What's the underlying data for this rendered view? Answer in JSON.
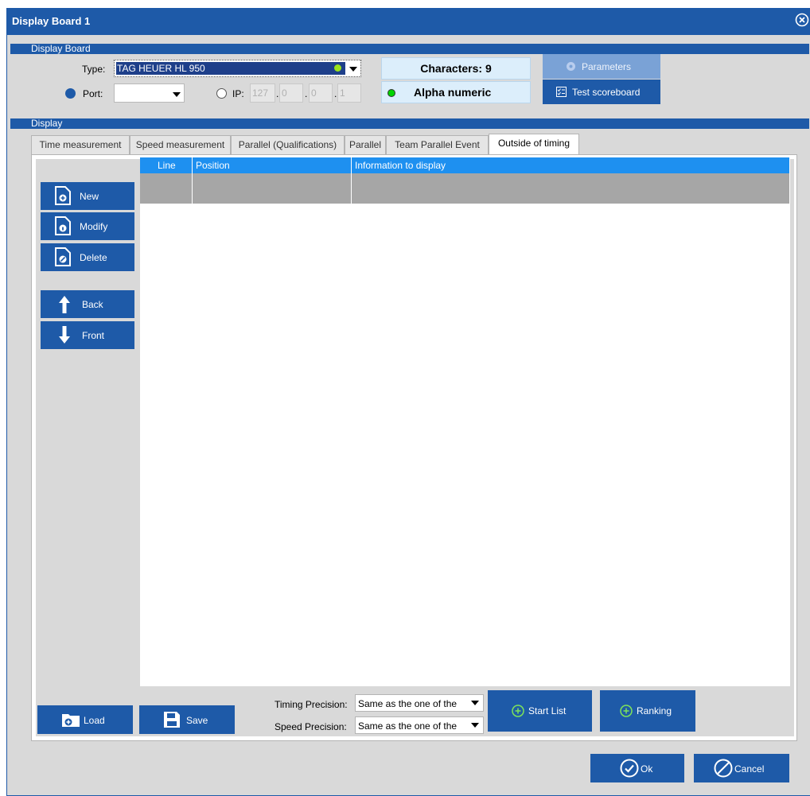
{
  "window": {
    "title": "Display Board 1"
  },
  "display_board": {
    "section_label": "Display Board",
    "type_label": "Type:",
    "type_value": "TAG HEUER HL 950",
    "port_label": "Port:",
    "port_value": "",
    "ip_label": "IP:",
    "ip": [
      "127",
      "0",
      "0",
      "1"
    ],
    "characters": "Characters: 9",
    "mode": "Alpha numeric",
    "parameters_label": "Parameters",
    "test_scoreboard_label": "Test scoreboard"
  },
  "display": {
    "section_label": "Display",
    "tabs": [
      {
        "label": "Time measurement",
        "active": false
      },
      {
        "label": "Speed measurement",
        "active": false
      },
      {
        "label": "Parallel (Qualifications)",
        "active": false
      },
      {
        "label": "Parallel",
        "active": false
      },
      {
        "label": "Team Parallel Event",
        "active": false
      },
      {
        "label": "Outside of timing",
        "active": true
      }
    ],
    "side_buttons": {
      "new": "New",
      "modify": "Modify",
      "delete": "Delete",
      "back": "Back",
      "front": "Front"
    },
    "table": {
      "columns": [
        "Line",
        "Position",
        "Information to display"
      ],
      "rows": [
        [
          "",
          "",
          ""
        ]
      ]
    },
    "bottom": {
      "load": "Load",
      "save": "Save",
      "timing_precision_label": "Timing Precision:",
      "timing_precision_value": "Same as the one of the",
      "speed_precision_label": "Speed Precision:",
      "speed_precision_value": "Same as the one of the",
      "start_list": "Start List",
      "ranking": "Ranking"
    }
  },
  "footer": {
    "ok": "Ok",
    "cancel": "Cancel"
  },
  "colors": {
    "brand_blue": "#1e5aa8",
    "grid_header": "#1e90f0",
    "status_green": "#00c800"
  }
}
